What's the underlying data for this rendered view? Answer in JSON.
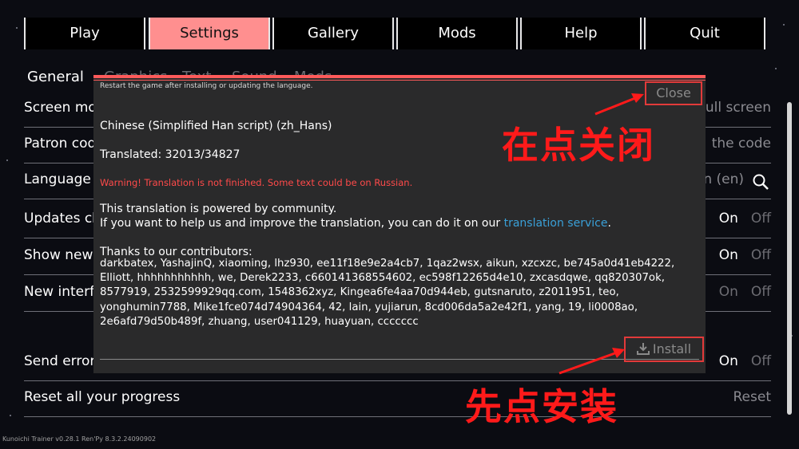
{
  "menu": {
    "tabs": [
      {
        "label": "Play"
      },
      {
        "label": "Settings"
      },
      {
        "label": "Gallery"
      },
      {
        "label": "Mods"
      },
      {
        "label": "Help"
      },
      {
        "label": "Quit"
      }
    ],
    "active": "Settings"
  },
  "subtabs": {
    "general": "General",
    "graphics": "Graphics",
    "text": "Text",
    "sound": "Sound",
    "mods": "Mods"
  },
  "settings": {
    "rows": [
      {
        "label": "Screen mo",
        "value": "Full screen"
      },
      {
        "label": "Patron cod",
        "value": "the code"
      },
      {
        "label": "Language",
        "value": "n (en)"
      },
      {
        "label": "Updates ch",
        "on": "On",
        "off": "Off"
      },
      {
        "label": "Show news",
        "on": "On",
        "off": "Off"
      },
      {
        "label": "New interf",
        "on": "On",
        "off": "Off"
      },
      {
        "label": "Send error",
        "on": "On",
        "off": "Off"
      },
      {
        "label": "Reset all your progress",
        "value": "Reset"
      }
    ]
  },
  "footer": {
    "version": "Kunoichi Trainer v0.28.1    Ren'Py 8.3.2.24090902"
  },
  "modal": {
    "hint": "Restart the game after installing or updating the language.",
    "close_label": "Close",
    "language_name": "Chinese (Simplified Han script) (zh_Hans)",
    "translated": "Translated: 32013/34827",
    "warning": "Warning! Translation is not finished. Some text could be on Russian.",
    "powered": "This translation is powered by community.",
    "help_prefix": "If you want to help us and improve the translation, you can do it on our ",
    "help_link": "translation service",
    "help_suffix": ".",
    "thanks": "Thanks to our contributors:",
    "contributors": "darkbatex, YashajinQ, xiaoming, lhz930, ee11f18e9e2a4cb7, 1qaz2wsx, aikun, xzcxzc, be745a0d41eb4222, Elliott, hhhhhhhhhhh, we, Derek2233, c660141368554602, ec598f12265d4e10, zxcasdqwe, qq820307ok, 8577919, 2532599929qq.com, 1548362xyz, Kingea6fe4aa70d944eb, gutsnaruto, z2011951, teo, yonghumin7788, Mike1fce074d74904364, 42, lain, yujiarun, 8cd006da5a2e42f1, yang, 19, li0008ao, 2e6afd79d50b489f, zhuang, user041129, huayuan, ccccccc",
    "install_label": "Install"
  },
  "annotations": {
    "close_note": "在点关闭",
    "install_note": "先点安装",
    "color": "#ff1a1a"
  }
}
